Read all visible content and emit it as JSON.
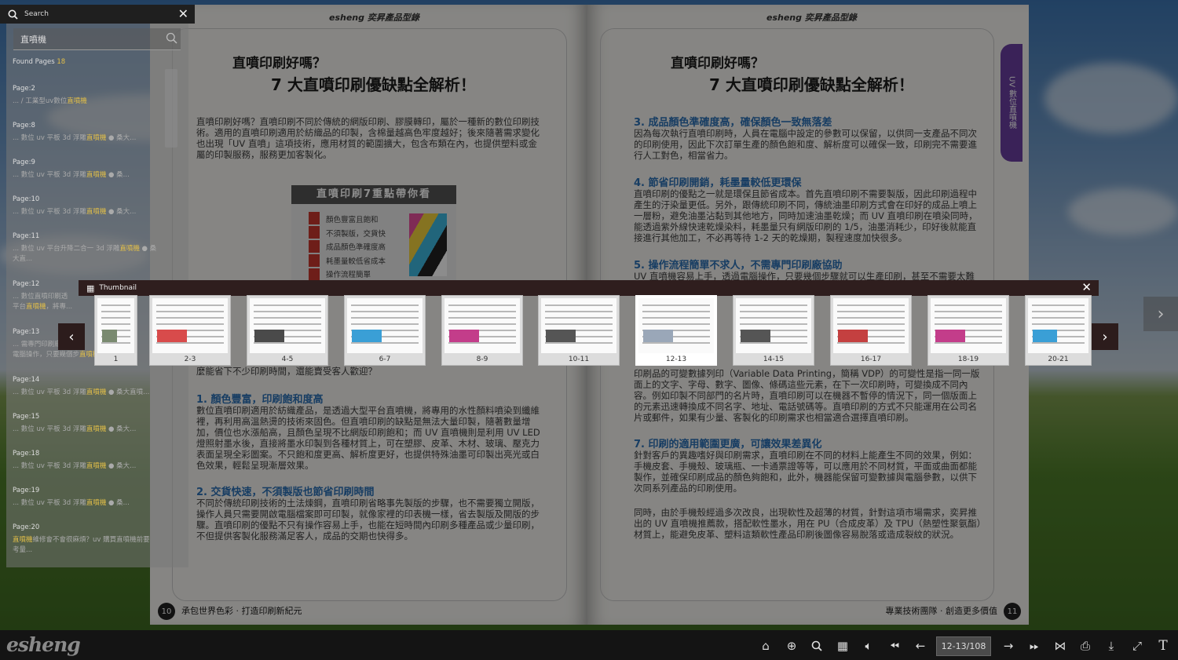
{
  "book": {
    "runhead": "esheng 奕昇產品型錄",
    "left": {
      "title1": "直噴印刷好嗎？",
      "title2": "7 大直噴印刷優缺點全解析！",
      "intro": "直噴印刷好嗎？直噴印刷不同於傳統的網版印刷、膠膜轉印，屬於一種新的數位印刷技術。適用的直噴印刷適用於紡織品的印製，含棉量越高色牢度越好；後來隨著需求變化也出現「UV 直噴」這項技術，應用材質的範圍擴大，包含布類在內，也提供塑料或金屬的印製服務，服務更加客製化。",
      "promo_title": "直噴印刷7重點帶你看",
      "promo_items": [
        "顏色豐富且飽和",
        "不須製版，交貨快",
        "成品顏色準確度高",
        "耗墨量較低省成本",
        "操作流程簡單"
      ],
      "behind_text": "麼能省下不少印刷時間，還能賣受客人歡迎？",
      "sec1": "1. 顏色豐富，印刷飽和度高",
      "sec1_text": "數位直噴印刷適用於紡織產品，是透過大型平台直噴機，將專用的水性顏料噴染到纖維裡，再利用高溫熱燙的技術來固色。但直噴印刷的缺點是無法大量印製，隨著數量增加，價位也水漲船高，且顏色呈現不比網版印刷飽和；而 UV 直噴機則是利用 UV LED 燈照射墨水後，直接將墨水印製到各種材質上，可在塑膠、皮革、木材、玻璃、壓克力表面呈現全彩圖案。不只飽和度更高、解析度更好，也提供特殊油墨可印製出亮光或白色效果，輕鬆呈現漸層效果。",
      "sec2": "2. 交貨快速，不須製版也節省印刷時間",
      "sec2_text": "不同於傳統印刷技術的土法煉鋼，直噴印刷省略事先製版的步驟，也不需要獨立開版，操作人員只需要開啟電腦檔案即可印製，就像家裡的印表機一樣，省去製版及開版的步驟。直噴印刷的優點不只有操作容易上手，也能在短時間內印刷多種產品或少量印刷，不但提供客製化服務滿足客人，成品的交期也快得多。",
      "page_num": "10",
      "footer": "承包世界色彩 · 打造印刷新紀元"
    },
    "right": {
      "title1": "直噴印刷好嗎？",
      "title2": "7 大直噴印刷優缺點全解析！",
      "side_tab": "UV 數位直噴機",
      "sec3": "3. 成品顏色準確度高，確保顏色一致無落差",
      "sec3_text": "因為每次執行直噴印刷時，人員在電腦中設定的參數可以保留，以供同一支產品不同次的印刷使用，因此下次訂單生產的顏色飽和度、解析度可以確保一致，印刷完不需要進行人工對色，相當省力。",
      "sec4": "4. 節省印刷開銷，耗墨量較低更環保",
      "sec4_text": "直噴印刷的優點之一就是環保且節省成本。首先直噴印刷不需要製版，因此印刷過程中產生的汙染量更低。另外，跟傳統印刷不同，傳統油墨印刷方式會在印好的成品上噴上一層粉，避免油墨沾黏到其他地方，同時加速油墨乾燥；而 UV 直噴印刷在噴染同時，能透過紫外線快速乾燥染料，耗墨量只有網版印刷的 1/5，油墨消耗少，印好後就能直接進行其他加工，不必再等待 1-2 天的乾燥期，製程速度加快很多。",
      "sec5": "5. 操作流程簡單不求人，不需專門印刷廠協助",
      "sec5_text": "UV 直噴機容易上手，透過電腦操作，只要幾個步驟就可以生產印刷，甚至不需要太難",
      "sec6_text": "印刷品的可變數據列印（Variable Data Printing，簡稱 VDP）的可變性是指一同一版面上的文字、字母、數字、圖像、條碼這些元素，在下一次印刷時，可變換成不同內容。例如印製不同部門的名片時，直噴印刷可以在機器不暫停的情況下，同一個版面上的元素迅速轉換成不同名字、地址、電話號碼等。直噴印刷的方式不只能運用在公司名片或郵件，如果有少量、客製化的印刷需求也相當適合選擇直噴印刷。",
      "sec7": "7. 印刷的適用範圍更廣，可讓效果差異化",
      "sec7_text": "針對客戶的異趣嗜好與印刷需求，直噴印刷在不同的材料上能產生不同的效果，例如：手機皮套、手機殼、玻璃瓶、一卡通票證等等，可以應用於不同材質，平面或曲面都能製作，並確保印刷成品的顏色夠飽和，此外，機器能保留可變數據與電腦參數，以供下次同系列產品的印刷使用。",
      "closing_text": "同時，由於手機殼經過多次改良，出現軟性及超薄的材質，針對這項市場需求，奕昇推出的 UV 直噴機推薦款，搭配軟性墨水，用在 PU（合成皮革）及 TPU（熱塑性聚氨酯）材質上，能避免皮革、塑料這類軟性產品印刷後圖像容易脫落或造成裂紋的狀況。",
      "page_num": "11",
      "footer": "專業技術團隊 · 創造更多價值"
    }
  },
  "search": {
    "header_label": "Search",
    "query": "直噴機",
    "found_label": "Found Pages",
    "found_count": "18",
    "keyword": "直噴機",
    "results": [
      {
        "page": "Page:2",
        "pre": "... / 工業型uv數位",
        "post": ""
      },
      {
        "page": "Page:8",
        "pre": "... 數位 uv 平板 3d 浮雕",
        "post": " ● 桑大..."
      },
      {
        "page": "Page:9",
        "pre": "... 數位 uv 平板 3d 浮雕",
        "post": " ● 桑..."
      },
      {
        "page": "Page:10",
        "pre": "... 數位 uv 平板 3d 浮雕",
        "post": " ● 桑大..."
      },
      {
        "page": "Page:11",
        "pre": "... 數位 uv 平台升降二合一 3d 浮雕",
        "post": " ● 桑\n大直..."
      },
      {
        "page": "Page:12",
        "pre": "... 數位直噴印刷透\n平台",
        "post": "，將專..."
      },
      {
        "page": "Page:13",
        "pre": "... 需專門印刷廠協\n電腦操作，只要幾個步",
        "post": ""
      },
      {
        "page": "Page:14",
        "pre": "... 數位 uv 平板 3d 浮雕",
        "post": " ● 桑大直噴..."
      },
      {
        "page": "Page:15",
        "pre": "... 數位 uv 平板 3d 浮雕",
        "post": " ● 桑大..."
      },
      {
        "page": "Page:18",
        "pre": "... 數位 uv 平板 3d 浮雕",
        "post": " ● 桑大..."
      },
      {
        "page": "Page:19",
        "pre": "... 數位 uv 平板 3d 浮雕",
        "post": " ● 桑..."
      },
      {
        "page": "Page:20",
        "pre": "",
        "post": "維修會不會很麻煩？uv 購買直噴機前要\n考量..."
      }
    ]
  },
  "thumbnails": {
    "header_label": "Thumbnail",
    "items": [
      {
        "label": "1",
        "accent": "#7a8a70"
      },
      {
        "label": "2-3",
        "accent": "#d84b4b"
      },
      {
        "label": "4-5",
        "accent": "#4a4a4a"
      },
      {
        "label": "6-7",
        "accent": "#3a9fd6"
      },
      {
        "label": "8-9",
        "accent": "#c33d8a"
      },
      {
        "label": "10-11",
        "accent": "#555555"
      },
      {
        "label": "12-13",
        "accent": "#9aa7b8"
      },
      {
        "label": "14-15",
        "accent": "#555555"
      },
      {
        "label": "16-17",
        "accent": "#c44040"
      },
      {
        "label": "18-19",
        "accent": "#c33d8a"
      },
      {
        "label": "20-21",
        "accent": "#3a9fd6"
      }
    ],
    "current": "12-13"
  },
  "toolbar": {
    "logo": "esheng",
    "page_indicator": "12-13/108",
    "buttons": [
      "home-icon",
      "zoom-in-icon",
      "search-icon",
      "thumbnail-grid-icon",
      "sound-icon",
      "first-page-icon",
      "prev-page-icon",
      "next-page-icon",
      "last-page-icon",
      "share-icon",
      "print-icon",
      "download-icon",
      "fullscreen-icon",
      "text-icon"
    ]
  }
}
